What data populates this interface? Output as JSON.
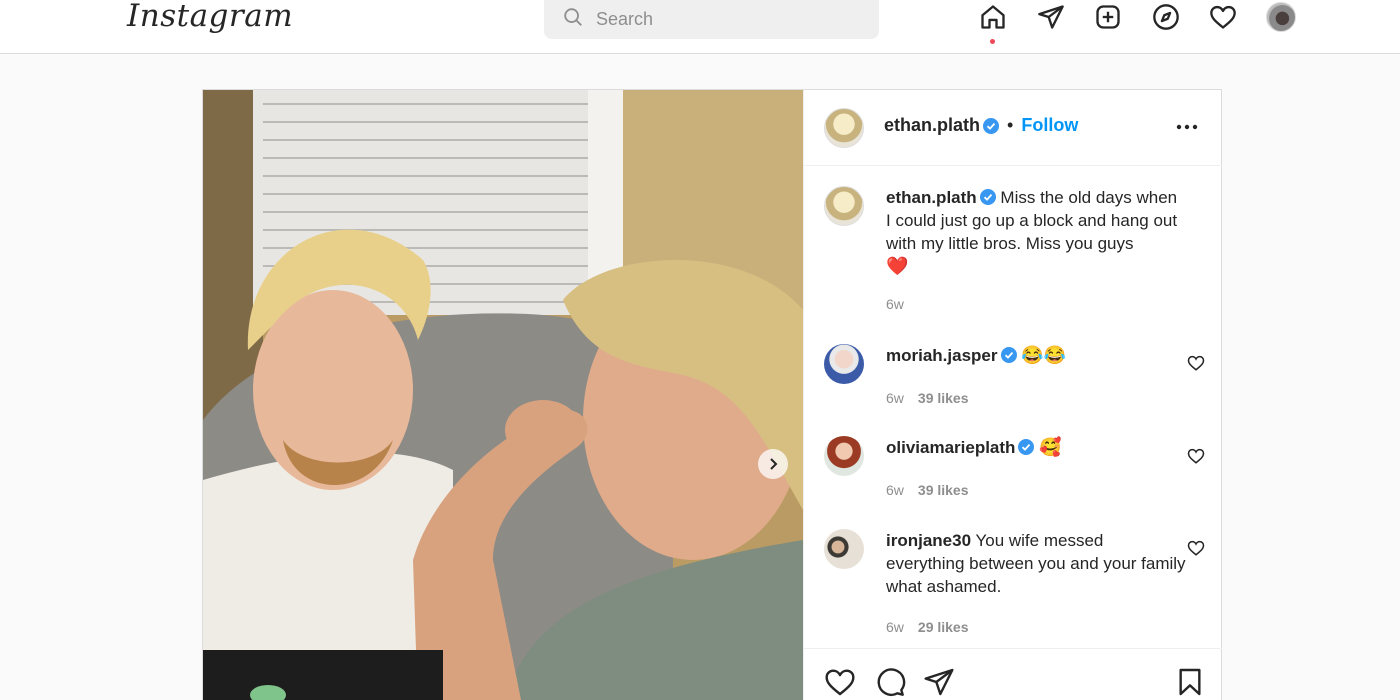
{
  "nav": {
    "logo": "Instagram",
    "search_placeholder": "Search",
    "icons": [
      "home-icon",
      "direct-icon",
      "new-post-icon",
      "explore-icon",
      "activity-icon",
      "profile-avatar"
    ]
  },
  "post": {
    "author": "ethan.plath",
    "follow_label": "Follow",
    "bullet": "•",
    "caption": {
      "username": "ethan.plath",
      "text": "Miss the old days when I could just go up a block and hang out with my little bros. Miss you guys",
      "emoji": "❤️",
      "time": "6w"
    },
    "comments": [
      {
        "username": "moriah.jasper",
        "verified": true,
        "text": "😂😂",
        "time": "6w",
        "likes": "39 likes"
      },
      {
        "username": "oliviamarieplath",
        "verified": true,
        "text": "🥰",
        "time": "6w",
        "likes": "39 likes"
      },
      {
        "username": "ironjane30",
        "verified": false,
        "text": "You wife messed everything between you and your family what ashamed.",
        "time": "6w",
        "likes": "29 likes"
      }
    ]
  },
  "colors": {
    "accent": "#0095f6",
    "verified": "#3897f0",
    "notification_dot": "#ed4956",
    "border": "#dbdbdb",
    "background": "#fafafa"
  }
}
